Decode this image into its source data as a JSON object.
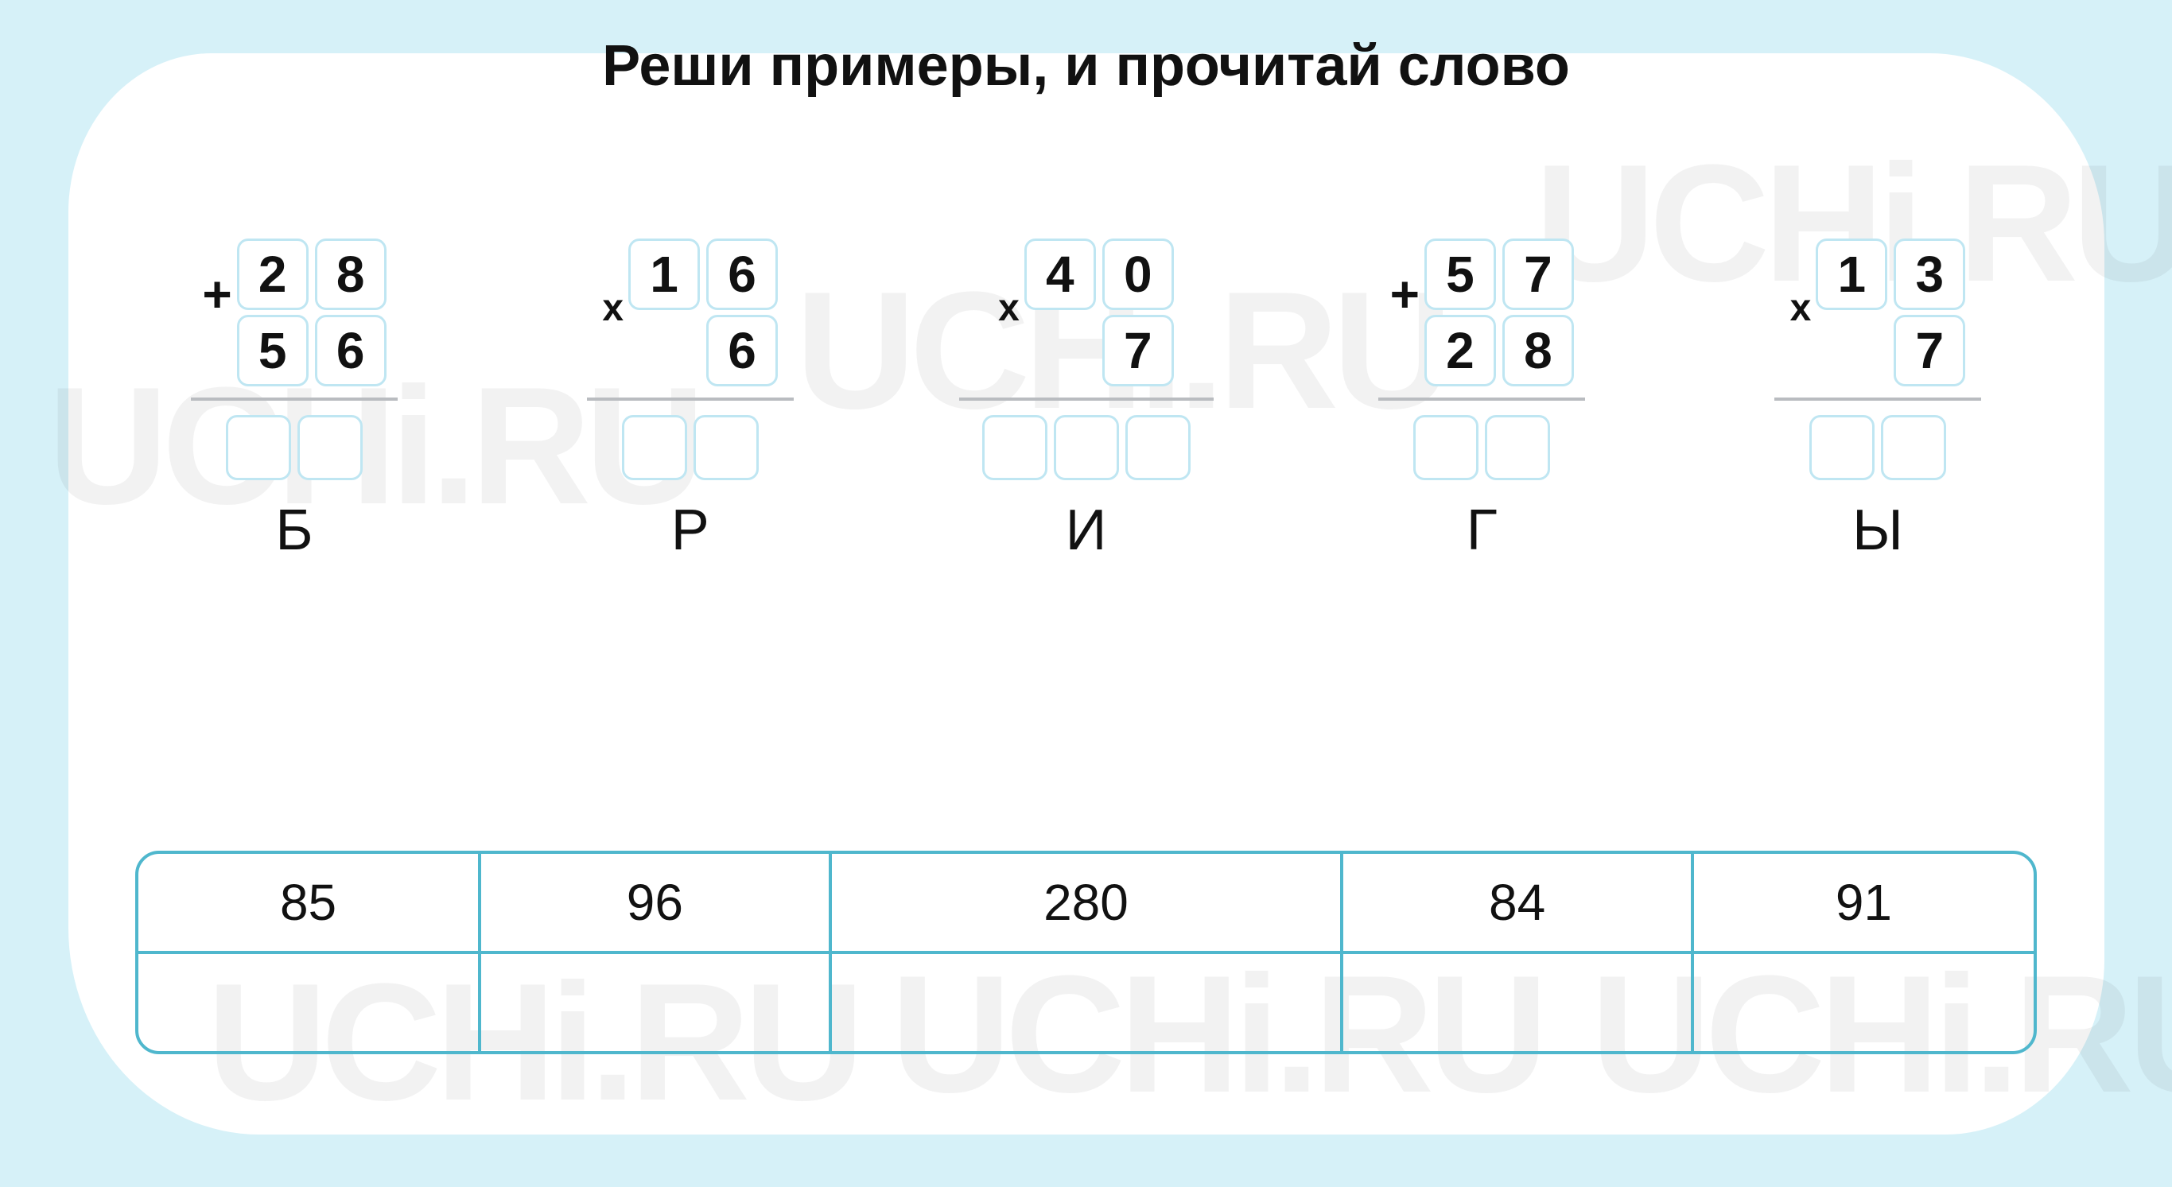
{
  "watermark_text": "UCHi.RU",
  "title": "Реши примеры, и прочитай слово",
  "problems": [
    {
      "op": "+",
      "row1": [
        "2",
        "8"
      ],
      "row2": [
        "5",
        "6"
      ],
      "answer_boxes": 2,
      "letter": "Б",
      "wide": false
    },
    {
      "op": "x",
      "row1": [
        "1",
        "6"
      ],
      "row2": [
        "",
        "6"
      ],
      "answer_boxes": 2,
      "letter": "Р",
      "wide": false
    },
    {
      "op": "x",
      "row1": [
        "4",
        "0"
      ],
      "row2": [
        "",
        "7"
      ],
      "answer_boxes": 3,
      "letter": "И",
      "wide": true
    },
    {
      "op": "+",
      "row1": [
        "5",
        "7"
      ],
      "row2": [
        "2",
        "8"
      ],
      "answer_boxes": 2,
      "letter": "Г",
      "wide": false
    },
    {
      "op": "x",
      "row1": [
        "1",
        "3"
      ],
      "row2": [
        "",
        "7"
      ],
      "answer_boxes": 2,
      "letter": "Ы",
      "wide": false
    }
  ],
  "answer_table": {
    "header_row": [
      "85",
      "96",
      "280",
      "84",
      "91"
    ],
    "input_row": [
      "",
      "",
      "",
      "",
      ""
    ]
  }
}
